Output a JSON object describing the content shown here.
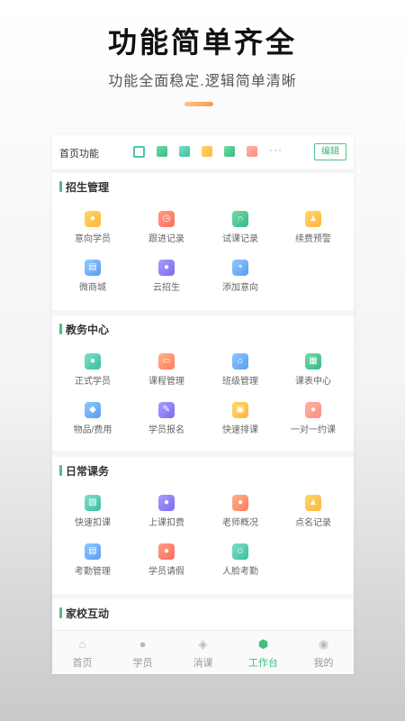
{
  "hero": {
    "title": "功能简单齐全",
    "subtitle": "功能全面稳定.逻辑简单清晰"
  },
  "quick": {
    "title": "首页功能",
    "more": "···",
    "edit": "编辑",
    "icons": [
      "qr-icon",
      "green-square-icon",
      "green-x-icon",
      "yellow-person-icon",
      "green-person-icon",
      "red-square-icon"
    ]
  },
  "sections": {
    "enroll": {
      "title": "招生管理",
      "items": [
        "意向学员",
        "跟进记录",
        "试课记录",
        "续费预警",
        "微商城",
        "云招生",
        "添加意向"
      ]
    },
    "academic": {
      "title": "教务中心",
      "items": [
        "正式学员",
        "课程管理",
        "班级管理",
        "课表中心",
        "物品/费用",
        "学员报名",
        "快速排课",
        "一对一约课"
      ]
    },
    "daily": {
      "title": "日常课务",
      "items": [
        "快速扣课",
        "上课扣费",
        "老师概况",
        "点名记录",
        "考勤管理",
        "学员请假",
        "人脸考勤"
      ]
    },
    "home_school": {
      "title": "家校互动"
    }
  },
  "tabbar": {
    "items": [
      "首页",
      "学员",
      "消课",
      "工作台",
      "我的"
    ],
    "active": "工作台"
  },
  "colors": {
    "accent": "#3fc07f",
    "hero_bar": "#ffa25a"
  }
}
